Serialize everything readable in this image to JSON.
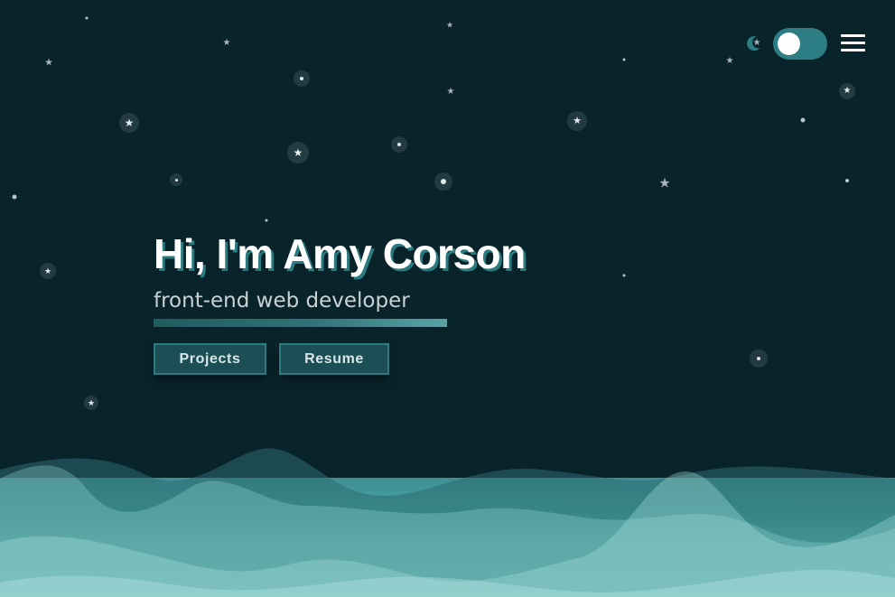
{
  "header": {
    "theme_icon": "moon-icon",
    "theme_toggle_on": true,
    "menu_icon": "hamburger-icon"
  },
  "hero": {
    "title": "Hi, I'm Amy Corson",
    "subtitle": "front-end web developer",
    "buttons": [
      {
        "label": "Projects"
      },
      {
        "label": "Resume"
      }
    ]
  },
  "colors": {
    "background": "#09232a",
    "accent": "#2d7e84",
    "wave_light": "#6fd0cb",
    "text": "#ffffff"
  },
  "icons": [
    "star-icon",
    "moon-icon",
    "hamburger-icon"
  ]
}
